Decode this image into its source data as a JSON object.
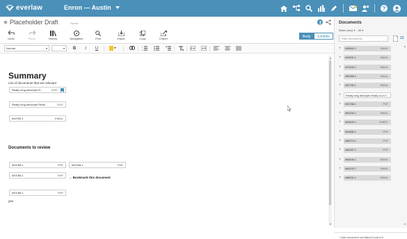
{
  "app": {
    "logo_text": "everlaw",
    "project_name": "Enron — Austin",
    "brand_color": "#4a90b8"
  },
  "top_icons": [
    "home-icon",
    "hierarchy-icon",
    "search-icon",
    "bar-chart-icon",
    "pen-icon",
    "mail-icon",
    "people-icon",
    "help-icon",
    "avatar-icon"
  ],
  "document": {
    "title": "Placeholder Draft",
    "status": "Saved"
  },
  "toolbar": {
    "items": [
      {
        "label": "Undo",
        "icon": "undo-icon",
        "enabled": true
      },
      {
        "label": "Redo",
        "icon": "redo-icon",
        "enabled": false
      },
      {
        "label": "History",
        "icon": "history-icon",
        "enabled": true
      },
      {
        "label": "Navigation",
        "icon": "compass-icon",
        "enabled": true
      },
      {
        "label": "Find",
        "icon": "search-icon",
        "enabled": true
      },
      {
        "label": "Import",
        "icon": "import-icon",
        "enabled": true
      },
      {
        "label": "Copy",
        "icon": "copy-icon",
        "enabled": true
      },
      {
        "label": "Export",
        "icon": "export-icon",
        "enabled": true
      }
    ],
    "tabs": [
      "Body",
      "Exhibits"
    ],
    "active_tab": "Body"
  },
  "format": {
    "style": "Normal",
    "size": ""
  },
  "content": {
    "heading": "Summary",
    "subtext": "List of documents that are relevant",
    "summary_docs": [
      {
        "name": "Really long descripto R...",
        "type": "DOC",
        "bookmark": true
      },
      {
        "name": "Really long descripto Reall...",
        "type": "DOC",
        "bookmark": false
      },
      {
        "name": "#52755.1",
        "type": "EMAIL",
        "bookmark": false
      }
    ],
    "review_heading": "Documents to review",
    "review_docs": [
      {
        "name": "#53788.1",
        "type": "PDF"
      },
      {
        "name": "#53788.1",
        "type": "PDF"
      },
      {
        "name": "#53788.1",
        "type": "PDF"
      },
      {
        "name": "#53788.1",
        "type": "PDF"
      }
    ],
    "note": "← Bookmark this document",
    "yes": "yes"
  },
  "panel": {
    "title": "Documents",
    "sort": "Bates (asc)",
    "filter_scope": "All",
    "filter_placeholder": "Filter documents",
    "count": "15",
    "add_label": "+ Add document via Bates/Control #",
    "docs": [
      {
        "name": "#38460.1",
        "type": "EMAIL",
        "alt": false
      },
      {
        "name": "#44691.1",
        "type": "EMAIL",
        "alt": false
      },
      {
        "name": "#47646.1",
        "type": "EMAIL",
        "alt": false
      },
      {
        "name": "#50068.1",
        "type": "EMAIL",
        "alt": false
      },
      {
        "name": "#52755.1",
        "type": "EMAIL",
        "alt": false
      },
      {
        "name": "Really long descripto Really lo...",
        "type": "DOC",
        "alt": true
      },
      {
        "name": "#53788.1",
        "type": "PDF",
        "alt": false
      },
      {
        "name": "#54294.1",
        "type": "EMAIL",
        "alt": false
      },
      {
        "name": "#54409.1",
        "type": "SHEET",
        "alt": false
      },
      {
        "name": "#54686.1",
        "type": "PDF",
        "alt": false
      },
      {
        "name": "#55079.1",
        "type": "PDF",
        "alt": false
      },
      {
        "name": "#55287.1",
        "type": "PDF",
        "alt": false
      },
      {
        "name": "#65406.1",
        "type": "EMAIL",
        "alt": false
      },
      {
        "name": "#66225.1",
        "type": "EMAIL",
        "alt": false
      },
      {
        "name": "#68094.1",
        "type": "EMAIL",
        "alt": false
      }
    ]
  }
}
